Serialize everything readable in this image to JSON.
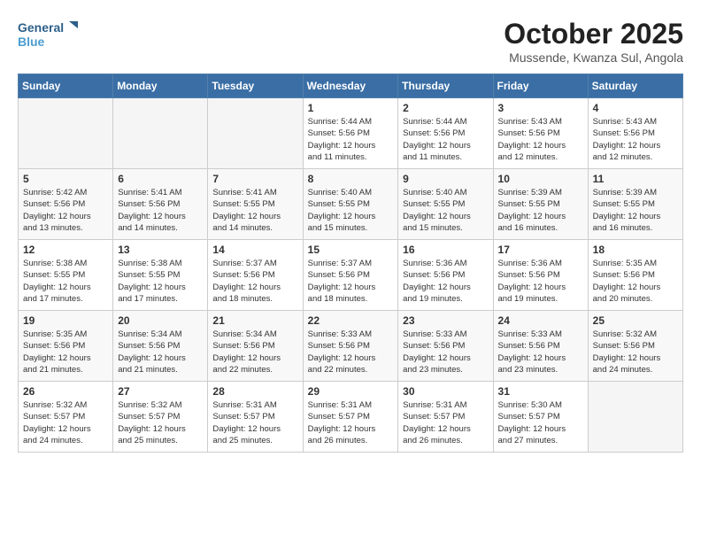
{
  "logo": {
    "line1": "General",
    "line2": "Blue"
  },
  "title": "October 2025",
  "location": "Mussende, Kwanza Sul, Angola",
  "headers": [
    "Sunday",
    "Monday",
    "Tuesday",
    "Wednesday",
    "Thursday",
    "Friday",
    "Saturday"
  ],
  "weeks": [
    [
      {
        "day": "",
        "info": ""
      },
      {
        "day": "",
        "info": ""
      },
      {
        "day": "",
        "info": ""
      },
      {
        "day": "1",
        "info": "Sunrise: 5:44 AM\nSunset: 5:56 PM\nDaylight: 12 hours\nand 11 minutes."
      },
      {
        "day": "2",
        "info": "Sunrise: 5:44 AM\nSunset: 5:56 PM\nDaylight: 12 hours\nand 11 minutes."
      },
      {
        "day": "3",
        "info": "Sunrise: 5:43 AM\nSunset: 5:56 PM\nDaylight: 12 hours\nand 12 minutes."
      },
      {
        "day": "4",
        "info": "Sunrise: 5:43 AM\nSunset: 5:56 PM\nDaylight: 12 hours\nand 12 minutes."
      }
    ],
    [
      {
        "day": "5",
        "info": "Sunrise: 5:42 AM\nSunset: 5:56 PM\nDaylight: 12 hours\nand 13 minutes."
      },
      {
        "day": "6",
        "info": "Sunrise: 5:41 AM\nSunset: 5:56 PM\nDaylight: 12 hours\nand 14 minutes."
      },
      {
        "day": "7",
        "info": "Sunrise: 5:41 AM\nSunset: 5:55 PM\nDaylight: 12 hours\nand 14 minutes."
      },
      {
        "day": "8",
        "info": "Sunrise: 5:40 AM\nSunset: 5:55 PM\nDaylight: 12 hours\nand 15 minutes."
      },
      {
        "day": "9",
        "info": "Sunrise: 5:40 AM\nSunset: 5:55 PM\nDaylight: 12 hours\nand 15 minutes."
      },
      {
        "day": "10",
        "info": "Sunrise: 5:39 AM\nSunset: 5:55 PM\nDaylight: 12 hours\nand 16 minutes."
      },
      {
        "day": "11",
        "info": "Sunrise: 5:39 AM\nSunset: 5:55 PM\nDaylight: 12 hours\nand 16 minutes."
      }
    ],
    [
      {
        "day": "12",
        "info": "Sunrise: 5:38 AM\nSunset: 5:55 PM\nDaylight: 12 hours\nand 17 minutes."
      },
      {
        "day": "13",
        "info": "Sunrise: 5:38 AM\nSunset: 5:55 PM\nDaylight: 12 hours\nand 17 minutes."
      },
      {
        "day": "14",
        "info": "Sunrise: 5:37 AM\nSunset: 5:56 PM\nDaylight: 12 hours\nand 18 minutes."
      },
      {
        "day": "15",
        "info": "Sunrise: 5:37 AM\nSunset: 5:56 PM\nDaylight: 12 hours\nand 18 minutes."
      },
      {
        "day": "16",
        "info": "Sunrise: 5:36 AM\nSunset: 5:56 PM\nDaylight: 12 hours\nand 19 minutes."
      },
      {
        "day": "17",
        "info": "Sunrise: 5:36 AM\nSunset: 5:56 PM\nDaylight: 12 hours\nand 19 minutes."
      },
      {
        "day": "18",
        "info": "Sunrise: 5:35 AM\nSunset: 5:56 PM\nDaylight: 12 hours\nand 20 minutes."
      }
    ],
    [
      {
        "day": "19",
        "info": "Sunrise: 5:35 AM\nSunset: 5:56 PM\nDaylight: 12 hours\nand 21 minutes."
      },
      {
        "day": "20",
        "info": "Sunrise: 5:34 AM\nSunset: 5:56 PM\nDaylight: 12 hours\nand 21 minutes."
      },
      {
        "day": "21",
        "info": "Sunrise: 5:34 AM\nSunset: 5:56 PM\nDaylight: 12 hours\nand 22 minutes."
      },
      {
        "day": "22",
        "info": "Sunrise: 5:33 AM\nSunset: 5:56 PM\nDaylight: 12 hours\nand 22 minutes."
      },
      {
        "day": "23",
        "info": "Sunrise: 5:33 AM\nSunset: 5:56 PM\nDaylight: 12 hours\nand 23 minutes."
      },
      {
        "day": "24",
        "info": "Sunrise: 5:33 AM\nSunset: 5:56 PM\nDaylight: 12 hours\nand 23 minutes."
      },
      {
        "day": "25",
        "info": "Sunrise: 5:32 AM\nSunset: 5:56 PM\nDaylight: 12 hours\nand 24 minutes."
      }
    ],
    [
      {
        "day": "26",
        "info": "Sunrise: 5:32 AM\nSunset: 5:57 PM\nDaylight: 12 hours\nand 24 minutes."
      },
      {
        "day": "27",
        "info": "Sunrise: 5:32 AM\nSunset: 5:57 PM\nDaylight: 12 hours\nand 25 minutes."
      },
      {
        "day": "28",
        "info": "Sunrise: 5:31 AM\nSunset: 5:57 PM\nDaylight: 12 hours\nand 25 minutes."
      },
      {
        "day": "29",
        "info": "Sunrise: 5:31 AM\nSunset: 5:57 PM\nDaylight: 12 hours\nand 26 minutes."
      },
      {
        "day": "30",
        "info": "Sunrise: 5:31 AM\nSunset: 5:57 PM\nDaylight: 12 hours\nand 26 minutes."
      },
      {
        "day": "31",
        "info": "Sunrise: 5:30 AM\nSunset: 5:57 PM\nDaylight: 12 hours\nand 27 minutes."
      },
      {
        "day": "",
        "info": ""
      }
    ]
  ]
}
